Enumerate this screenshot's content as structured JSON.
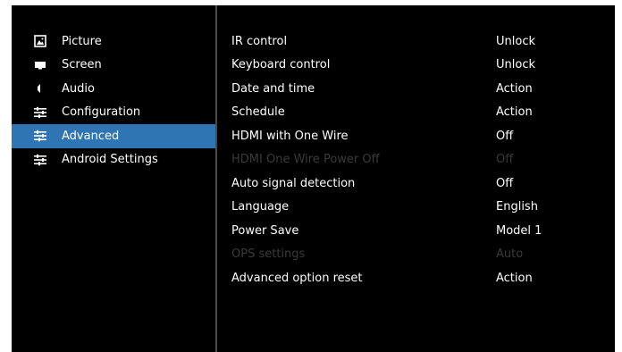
{
  "sidebar": {
    "items": [
      {
        "label": "Picture",
        "icon": "picture-icon",
        "active": false
      },
      {
        "label": "Screen",
        "icon": "screen-icon",
        "active": false
      },
      {
        "label": "Audio",
        "icon": "speaker-icon",
        "active": false
      },
      {
        "label": "Configuration",
        "icon": "sliders-icon",
        "active": false
      },
      {
        "label": "Advanced",
        "icon": "sliders-icon",
        "active": true
      },
      {
        "label": "Android Settings",
        "icon": "sliders-icon",
        "active": false
      }
    ]
  },
  "settings": {
    "rows": [
      {
        "label": "IR control",
        "value": "Unlock",
        "enabled": true
      },
      {
        "label": "Keyboard control",
        "value": "Unlock",
        "enabled": true
      },
      {
        "label": "Date and time",
        "value": "Action",
        "enabled": true
      },
      {
        "label": "Schedule",
        "value": "Action",
        "enabled": true
      },
      {
        "label": "HDMI with One Wire",
        "value": "Off",
        "enabled": true
      },
      {
        "label": "HDMI One Wire Power Off",
        "value": "Off",
        "enabled": false
      },
      {
        "label": "Auto signal detection",
        "value": "Off",
        "enabled": true
      },
      {
        "label": "Language",
        "value": "English",
        "enabled": true
      },
      {
        "label": "Power Save",
        "value": "Model 1",
        "enabled": true
      },
      {
        "label": "OPS settings",
        "value": "Auto",
        "enabled": false
      },
      {
        "label": "Advanced option reset",
        "value": "Action",
        "enabled": true
      }
    ]
  },
  "colors": {
    "background": "#000000",
    "highlight": "#2f74b3",
    "text": "#ffffff",
    "disabled_text": "#3a3a3a",
    "divider": "#4a4a4a"
  }
}
